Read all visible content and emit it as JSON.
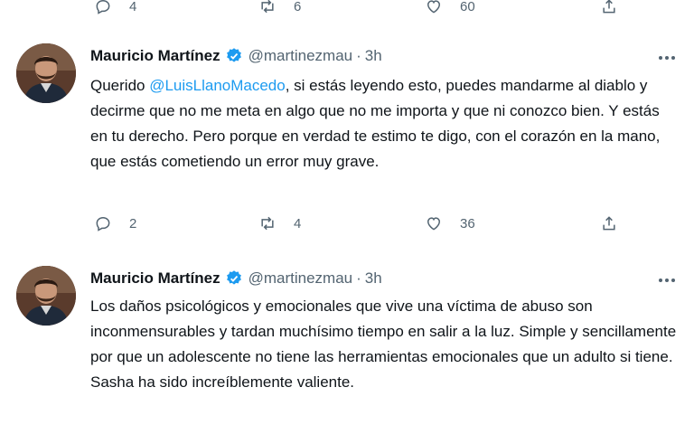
{
  "top_actions": {
    "reply_count": "4",
    "retweet_count": "6",
    "like_count": "60"
  },
  "tweets": [
    {
      "name": "Mauricio Martínez",
      "handle": "@martinezmau",
      "separator": "·",
      "time": "3h",
      "text_before": "Querido ",
      "mention": "@LuisLlanoMacedo",
      "text_after": ", si estás leyendo esto, puedes mandarme al diablo y decirme que no me meta en algo que no me importa y que ni conozco bien. Y estás en tu derecho. Pero porque en verdad te estimo te digo, con el corazón en la mano, que estás cometiendo un error muy grave.",
      "reply_count": "2",
      "retweet_count": "4",
      "like_count": "36"
    },
    {
      "name": "Mauricio Martínez",
      "handle": "@martinezmau",
      "separator": "·",
      "time": "3h",
      "text": "Los daños psicológicos y emocionales que vive una víctima de abuso son inconmensurables y tardan muchísimo tiempo en salir a la luz. Simple y sencillamente por que un adolescente no tiene las herramientas emocionales que un adulto si tiene. Sasha ha sido increíblemente valiente."
    }
  ],
  "icons": {
    "reply": "reply-icon",
    "retweet": "retweet-icon",
    "like": "heart-icon",
    "share": "share-icon",
    "verified": "verified-badge-icon",
    "more": "more-options-icon"
  },
  "colors": {
    "accent": "#1d9bf0",
    "muted": "#536471",
    "text": "#0f1419"
  }
}
